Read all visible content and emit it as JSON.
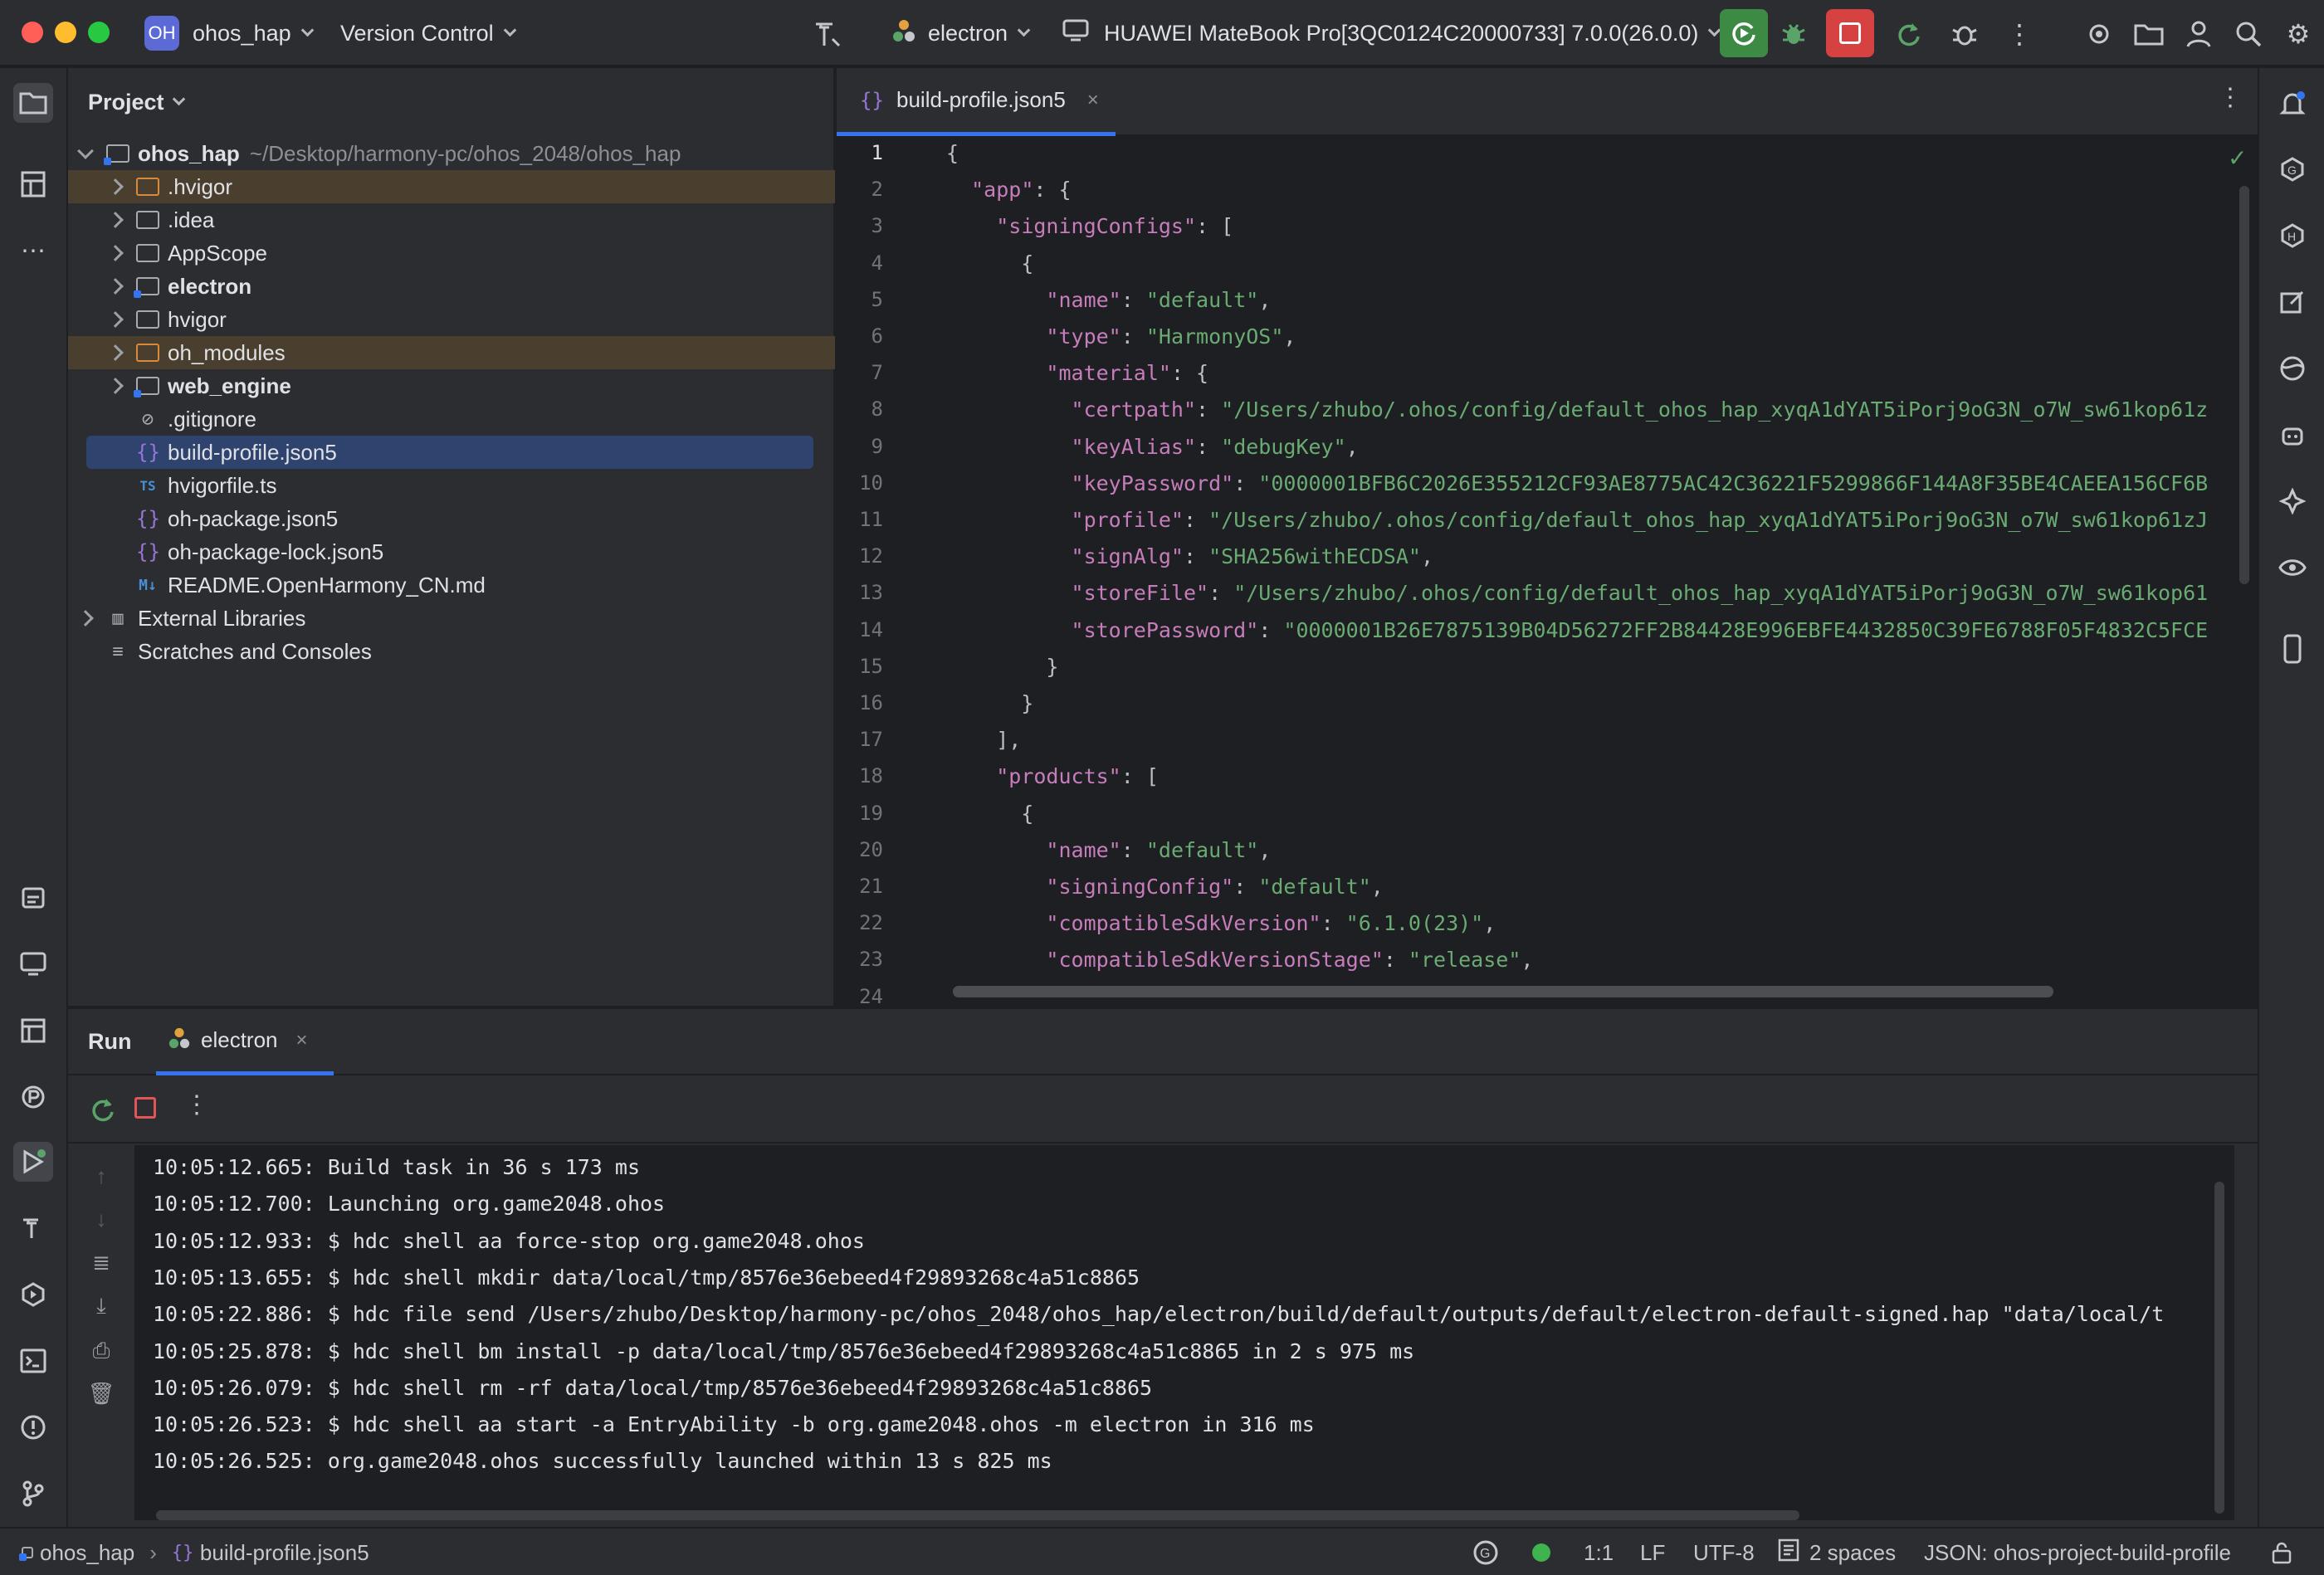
{
  "titlebar": {
    "project_badge": "OH",
    "project_name": "ohos_hap",
    "vcs": "Version Control",
    "run_config": "electron",
    "device": "HUAWEI MateBook Pro[3QC0124C20000733] 7.0.0(26.0.0)"
  },
  "project_panel": {
    "title": "Project",
    "root_name": "ohos_hap",
    "root_path": "~/Desktop/harmony-pc/ohos_2048/ohos_hap",
    "items": [
      {
        "label": ".hvigor"
      },
      {
        "label": ".idea"
      },
      {
        "label": "AppScope"
      },
      {
        "label": "electron"
      },
      {
        "label": "hvigor"
      },
      {
        "label": "oh_modules"
      },
      {
        "label": "web_engine"
      },
      {
        "label": ".gitignore"
      },
      {
        "label": "build-profile.json5"
      },
      {
        "label": "hvigorfile.ts"
      },
      {
        "label": "oh-package.json5"
      },
      {
        "label": "oh-package-lock.json5"
      },
      {
        "label": "README.OpenHarmony_CN.md"
      },
      {
        "label": "External Libraries"
      },
      {
        "label": "Scratches and Consoles"
      }
    ]
  },
  "editor": {
    "tab": "build-profile.json5",
    "line_numbers": [
      "1",
      "2",
      "3",
      "4",
      "5",
      "6",
      "7",
      "8",
      "9",
      "10",
      "11",
      "12",
      "13",
      "14",
      "15",
      "16",
      "17",
      "18",
      "19",
      "20",
      "21",
      "22",
      "23",
      "24"
    ],
    "lines": [
      "{",
      "  \"app\": {",
      "    \"signingConfigs\": [",
      "      {",
      "        \"name\": \"default\",",
      "        \"type\": \"HarmonyOS\",",
      "        \"material\": {",
      "          \"certpath\": \"/Users/zhubo/.ohos/config/default_ohos_hap_xyqA1dYAT5iPorj9oG3N_o7W_sw61kop61z",
      "          \"keyAlias\": \"debugKey\",",
      "          \"keyPassword\": \"0000001BFB6C2026E355212CF93AE8775AC42C36221F5299866F144A8F35BE4CAEEA156CF6B",
      "          \"profile\": \"/Users/zhubo/.ohos/config/default_ohos_hap_xyqA1dYAT5iPorj9oG3N_o7W_sw61kop61zJ",
      "          \"signAlg\": \"SHA256withECDSA\",",
      "          \"storeFile\": \"/Users/zhubo/.ohos/config/default_ohos_hap_xyqA1dYAT5iPorj9oG3N_o7W_sw61kop61",
      "          \"storePassword\": \"0000001B26E7875139B04D56272FF2B84428E996EBFE4432850C39FE6788F05F4832C5FCE",
      "        }",
      "      }",
      "    ],",
      "    \"products\": [",
      "      {",
      "        \"name\": \"default\",",
      "        \"signingConfig\": \"default\",",
      "        \"compatibleSdkVersion\": \"6.1.0(23)\",",
      "        \"compatibleSdkVersionStage\": \"release\",",
      ""
    ]
  },
  "run_panel": {
    "tab_run": "Run",
    "tab_config": "electron",
    "console": [
      "10:05:12.665: Build task in 36 s 173 ms",
      "10:05:12.700: Launching org.game2048.ohos",
      "10:05:12.933: $ hdc shell aa force-stop org.game2048.ohos",
      "10:05:13.655: $ hdc shell mkdir data/local/tmp/8576e36ebeed4f29893268c4a51c8865",
      "10:05:22.886: $ hdc file send /Users/zhubo/Desktop/harmony-pc/ohos_2048/ohos_hap/electron/build/default/outputs/default/electron-default-signed.hap \"data/local/t",
      "10:05:25.878: $ hdc shell bm install -p data/local/tmp/8576e36ebeed4f29893268c4a51c8865 in 2 s 975 ms",
      "10:05:26.079: $ hdc shell rm -rf data/local/tmp/8576e36ebeed4f29893268c4a51c8865",
      "10:05:26.523: $ hdc shell aa start -a EntryAbility -b org.game2048.ohos -m electron in 316 ms",
      "10:05:26.525: org.game2048.ohos successfully launched within 13 s 825 ms"
    ]
  },
  "statusbar": {
    "breadcrumb_project": "ohos_hap",
    "breadcrumb_file": "build-profile.json5",
    "position": "1:1",
    "line_sep": "LF",
    "encoding": "UTF-8",
    "indent": "2 spaces",
    "schema": "JSON: ohos-project-build-profile"
  },
  "colors": {
    "accent": "#3574f0",
    "run_green": "#3d8a45",
    "stop_red": "#d64242",
    "string_green": "#6aab73",
    "key_purple": "#c77dbb"
  }
}
